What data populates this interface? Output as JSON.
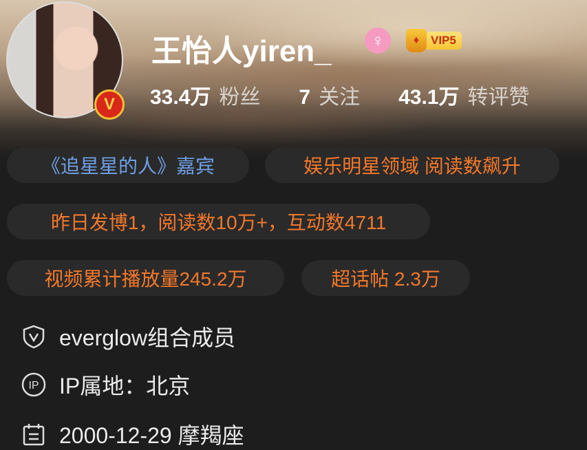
{
  "profile": {
    "name": "王怡人yiren_",
    "gender_icon": "female-icon",
    "vip_label": "VIP5",
    "verified_badge": "V",
    "stats": [
      {
        "value": "33.4万",
        "label": "粉丝"
      },
      {
        "value": "7",
        "label": "关注"
      },
      {
        "value": "43.1万",
        "label": "转评赞"
      }
    ]
  },
  "tags": [
    {
      "text": "《追星星的人》嘉宾",
      "color": "#6f9fe4"
    },
    {
      "text": "娱乐明星领域 阅读数飙升",
      "color": "#f3782a"
    },
    {
      "text": "昨日发博1，阅读数10万+，互动数4711",
      "color": "#f3782a"
    },
    {
      "text": "视频累计播放量245.2万",
      "color": "#f3782a"
    },
    {
      "text": "超话帖 2.3万",
      "color": "#f3782a"
    }
  ],
  "info": [
    {
      "icon": "shield-v-icon",
      "text": "everglow组合成员"
    },
    {
      "icon": "ip-icon",
      "text": "IP属地：北京"
    },
    {
      "icon": "calendar-icon",
      "text": "2000-12-29 摩羯座"
    }
  ]
}
